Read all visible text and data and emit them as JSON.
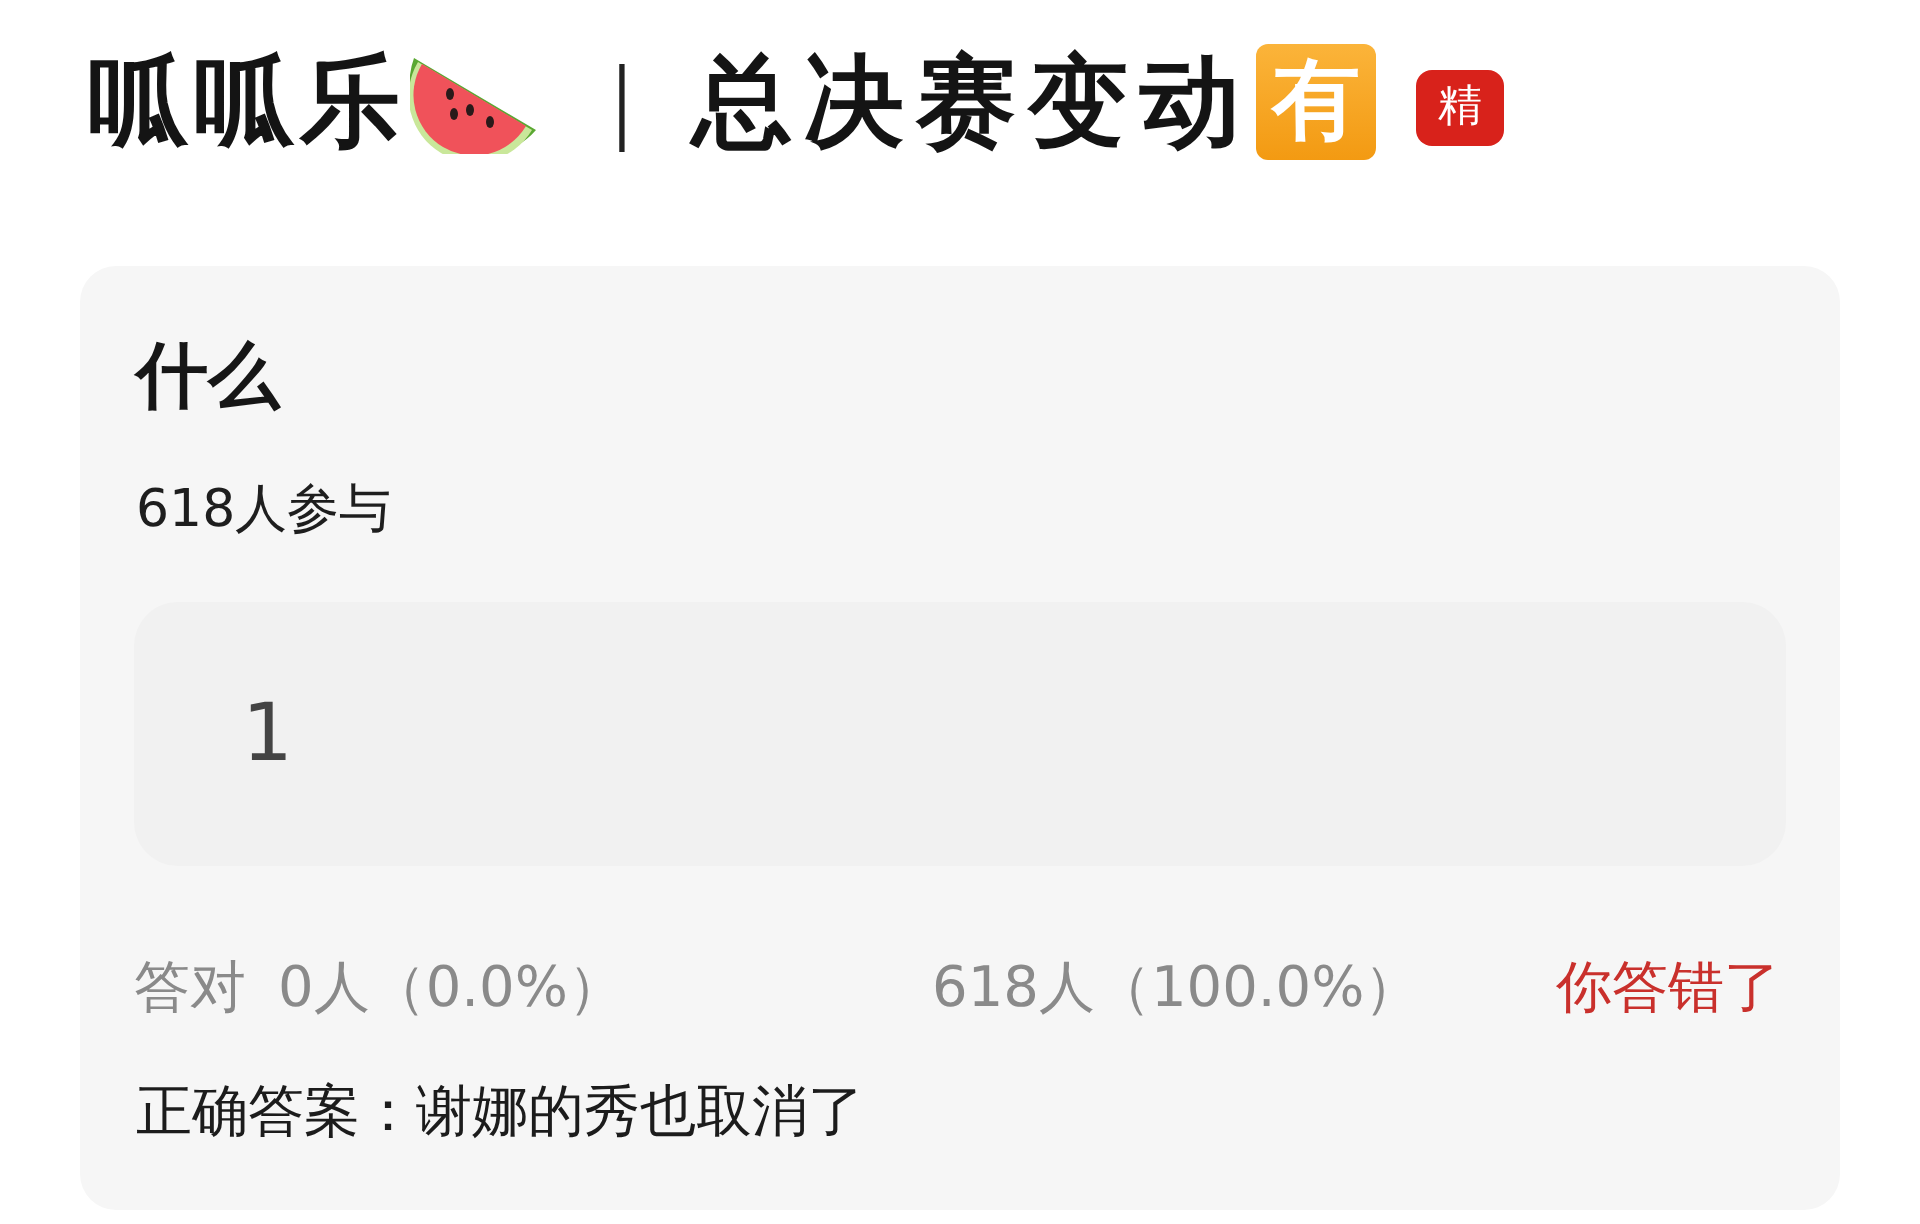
{
  "header": {
    "title": "呱呱乐",
    "separator": "｜",
    "subtitle": "总决赛变动",
    "emoji_tile": "有",
    "badge": "精"
  },
  "quiz": {
    "question": "什么",
    "participants": "618人参与",
    "answer": "1",
    "results": {
      "correct_label": "答对",
      "correct_count": "0人（0.0%）",
      "wrong_count": "618人（100.0%）",
      "verdict": "你答错了"
    },
    "correct_answer": "正确答案：谢娜的秀也取消了"
  }
}
